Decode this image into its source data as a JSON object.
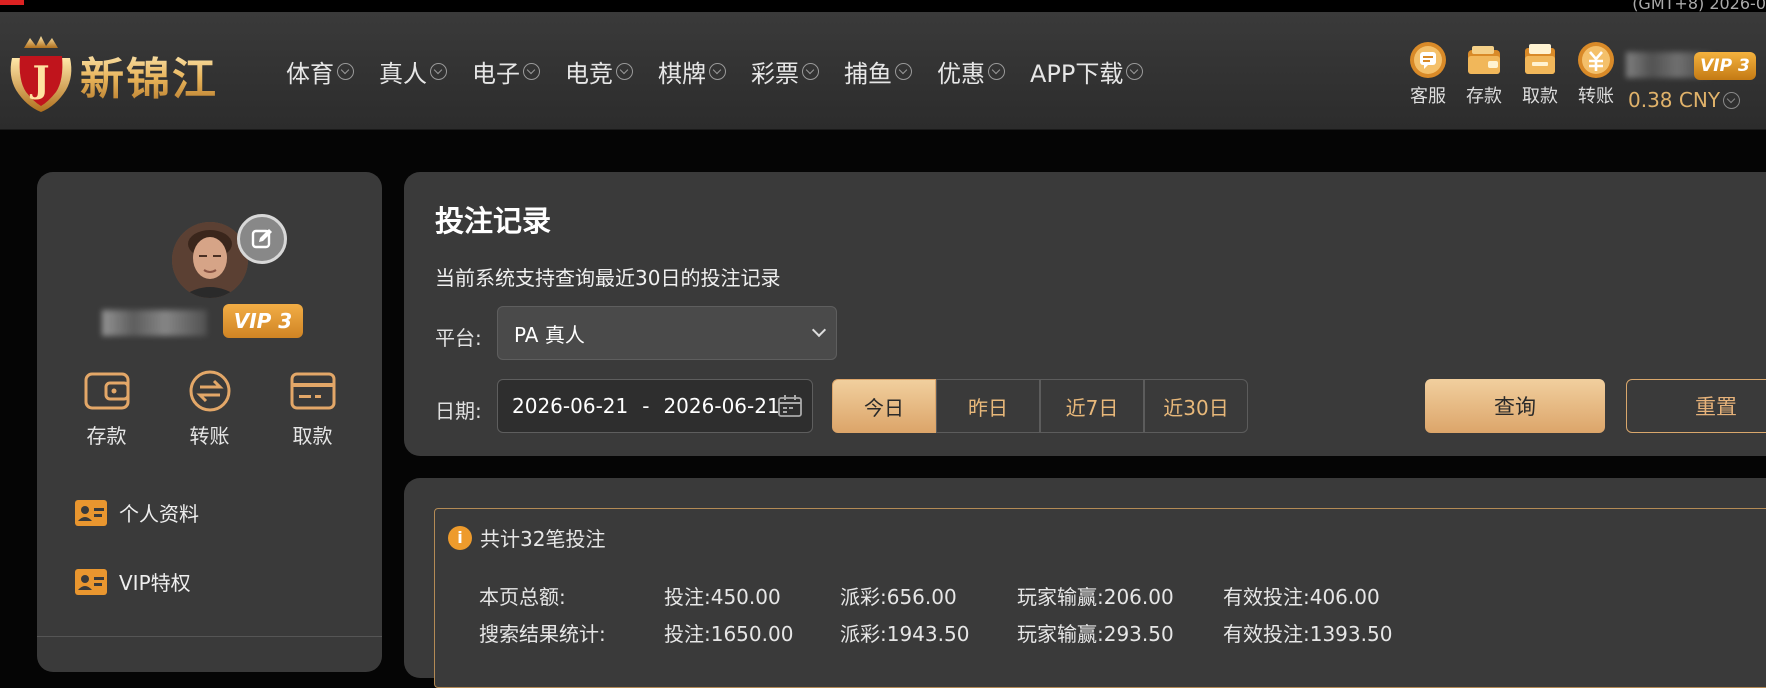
{
  "top_corner_text": "(GMT+8) 2026-0",
  "brand": {
    "name": "新锦江",
    "badge_letter": "J"
  },
  "nav": [
    {
      "label": "体育"
    },
    {
      "label": "真人"
    },
    {
      "label": "电子"
    },
    {
      "label": "电竞"
    },
    {
      "label": "棋牌"
    },
    {
      "label": "彩票"
    },
    {
      "label": "捕鱼"
    },
    {
      "label": "优惠"
    },
    {
      "label": "APP下载"
    }
  ],
  "header_actions": [
    {
      "label": "客服",
      "icon": "chat-icon"
    },
    {
      "label": "存款",
      "icon": "wallet-icon"
    },
    {
      "label": "取款",
      "icon": "withdraw-icon"
    },
    {
      "label": "转账",
      "icon": "transfer-icon"
    }
  ],
  "user": {
    "vip_label": "VIP 3",
    "balance": "0.38 CNY"
  },
  "sidebar": {
    "vip_label": "VIP 3",
    "actions": [
      {
        "label": "存款",
        "icon": "wallet-icon"
      },
      {
        "label": "转账",
        "icon": "transfer-icon"
      },
      {
        "label": "取款",
        "icon": "card-icon"
      }
    ],
    "menu": [
      {
        "label": "个人资料",
        "icon": "id-card-icon"
      },
      {
        "label": "VIP特权",
        "icon": "id-card-icon"
      }
    ]
  },
  "filter": {
    "title": "投注记录",
    "note": "当前系统支持查询最近30日的投注记录",
    "platform_label": "平台:",
    "platform_value": "PA 真人",
    "date_label": "日期:",
    "date_start": "2026-06-21",
    "date_sep": "-",
    "date_end": "2026-06-21",
    "quick_ranges": [
      "今日",
      "昨日",
      "近7日",
      "近30日"
    ],
    "active_range": "今日",
    "query_label": "查询",
    "reset_label": "重置"
  },
  "results": {
    "info": "共计32笔投注",
    "rows": [
      {
        "label": "本页总额:",
        "bet": "投注:450.00",
        "payout": "派彩:656.00",
        "win": "玩家输赢:206.00",
        "valid": "有效投注:406.00"
      },
      {
        "label": "搜索结果统计:",
        "bet": "投注:1650.00",
        "payout": "派彩:1943.50",
        "win": "玩家输赢:293.50",
        "valid": "有效投注:1393.50"
      }
    ]
  },
  "colors": {
    "accent_gold": "#dca56a",
    "vip_orange": "#f2ad45",
    "panel": "#3a3a3a"
  }
}
